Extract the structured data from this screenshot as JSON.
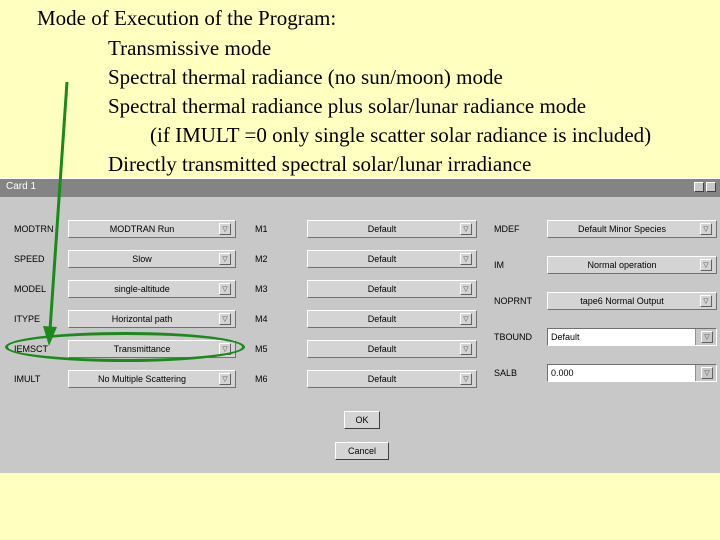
{
  "slide": {
    "title": "Mode of Execution of the Program:",
    "items": [
      "Transmissive mode",
      "Spectral thermal radiance (no sun/moon) mode",
      "Spectral thermal radiance plus solar/lunar radiance mode",
      "(if IMULT =0 only single scatter solar radiance is included)",
      "Directly transmitted spectral solar/lunar irradiance"
    ]
  },
  "window": {
    "title": "Card 1"
  },
  "col1": [
    {
      "label": "MODTRN",
      "value": "MODTRAN Run"
    },
    {
      "label": "SPEED",
      "value": "Slow"
    },
    {
      "label": "MODEL",
      "value": "single-altitude"
    },
    {
      "label": "ITYPE",
      "value": "Horizontal path"
    },
    {
      "label": "IEMSCT",
      "value": "Transmittance"
    },
    {
      "label": "IMULT",
      "value": "No Multiple Scattering"
    }
  ],
  "col2": [
    {
      "label": "M1",
      "value": "Default"
    },
    {
      "label": "M2",
      "value": "Default"
    },
    {
      "label": "M3",
      "value": "Default"
    },
    {
      "label": "M4",
      "value": "Default"
    },
    {
      "label": "M5",
      "value": "Default"
    },
    {
      "label": "M6",
      "value": "Default"
    }
  ],
  "col3": {
    "mdef": {
      "label": "MDEF",
      "value": "Default Minor Species"
    },
    "im": {
      "label": "IM",
      "value": "Normal operation"
    },
    "noprnt": {
      "label": "NOPRNT",
      "value": "tape6 Normal Output"
    },
    "tbound": {
      "label": "TBOUND",
      "value": "Default"
    },
    "salb": {
      "label": "SALB",
      "value": "0.000"
    }
  },
  "buttons": {
    "ok": "OK",
    "cancel": "Cancel"
  },
  "colors": {
    "slide_bg": "#ffffc0",
    "window_bg": "#c8c8c8",
    "highlight": "#1a8a1a"
  }
}
